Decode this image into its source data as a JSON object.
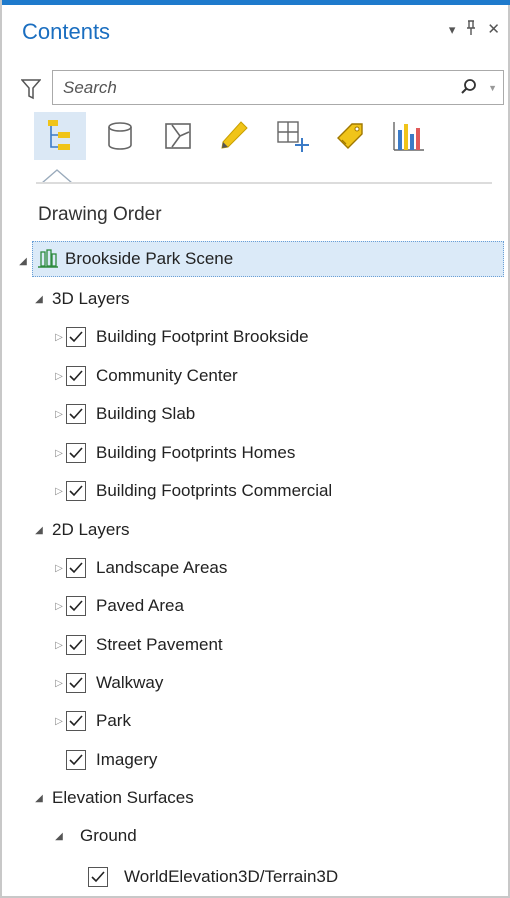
{
  "pane": {
    "title": "Contents",
    "controls": {
      "dropdown": "▾",
      "pin": "ᚨ",
      "close": "✕"
    }
  },
  "search": {
    "placeholder": "Search"
  },
  "toolbar": {
    "tools": [
      {
        "name": "list-by-drawing-order",
        "icon": "drawing-order-icon",
        "active": true
      },
      {
        "name": "list-by-data-source",
        "icon": "data-source-icon"
      },
      {
        "name": "list-by-selection",
        "icon": "selection-icon"
      },
      {
        "name": "list-by-editing",
        "icon": "editing-pencil-icon"
      },
      {
        "name": "list-by-snapping",
        "icon": "snapping-icon"
      },
      {
        "name": "list-by-labeling",
        "icon": "labeling-tag-icon"
      },
      {
        "name": "list-by-charts",
        "icon": "charts-icon"
      }
    ]
  },
  "section": {
    "heading": "Drawing Order"
  },
  "tree": {
    "scene": "Brookside Park Scene",
    "group_3d": "3D Layers",
    "layers_3d": [
      "Building Footprint Brookside",
      "Community Center",
      "Building Slab",
      "Building Footprints Homes",
      "Building Footprints Commercial"
    ],
    "group_2d": "2D Layers",
    "layers_2d": [
      "Landscape Areas",
      "Paved Area",
      "Street Pavement",
      "Walkway",
      "Park",
      "Imagery"
    ],
    "group_elev": "Elevation Surfaces",
    "ground": "Ground",
    "terrain": "WorldElevation3D/Terrain3D"
  },
  "colors": {
    "accent": "#1e7acc",
    "title": "#1a6ec0",
    "selection": "#dbeaf8",
    "icon_yellow": "#f0c419"
  }
}
